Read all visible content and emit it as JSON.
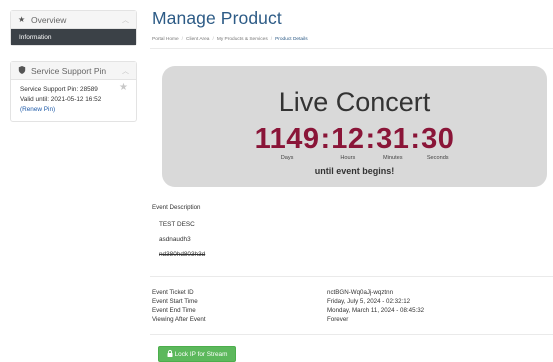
{
  "sidebar": {
    "overview": {
      "label": "Overview",
      "active_item": "Information"
    },
    "support": {
      "label": "Service Support Pin",
      "pin_line": "Service Support Pin: 28589",
      "valid_line": "Valid until: 2021-05-12 16:52",
      "renew_label": "(Renew Pin)"
    }
  },
  "main": {
    "title": "Manage Product",
    "breadcrumb": [
      "Portal Home",
      "Client Area",
      "My Products & Services",
      "Product Details"
    ],
    "countdown": {
      "event_name": "Live Concert",
      "days": "1149",
      "hours": "12",
      "minutes": "31",
      "seconds": "30",
      "days_label": "Days",
      "hours_label": "Hours",
      "minutes_label": "Minutes",
      "seconds_label": "Seconds",
      "footer": "until event begins!"
    },
    "description": {
      "label": "Event Description",
      "lines": [
        "TEST DESC",
        "asdnaudh3",
        "nd380hd803h3d"
      ]
    },
    "info": [
      {
        "key": "Event Ticket ID",
        "value": "nctBGN-Wq0aJj-wqztnn"
      },
      {
        "key": "Event Start Time",
        "value": "Friday, July 5, 2024 - 02:32:12"
      },
      {
        "key": "Event End Time",
        "value": "Monday, March 11, 2024 - 08:45:32"
      },
      {
        "key": "Viewing After Event",
        "value": "Forever"
      }
    ],
    "lock_button_label": "Lock IP for Stream"
  },
  "colors": {
    "title_blue": "#2d5b86",
    "countdown_red": "#8a1538",
    "button_green": "#5cb85c"
  },
  "icons": [
    "star-icon",
    "chevron-up-icon",
    "shield-icon",
    "lock-icon"
  ]
}
